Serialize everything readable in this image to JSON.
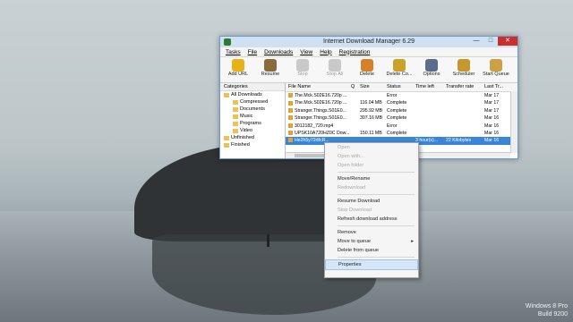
{
  "window": {
    "title": "Internet Download Manager 6.29",
    "controls": {
      "minimize": "—",
      "maximize": "□",
      "close": "✕"
    }
  },
  "menu": [
    "Tasks",
    "File",
    "Downloads",
    "View",
    "Help",
    "Registration"
  ],
  "toolbar": [
    {
      "label": "Add URL",
      "icon": "add-url-icon",
      "color": "#e7b219",
      "enabled": true
    },
    {
      "label": "Resume",
      "icon": "resume-icon",
      "color": "#8a6b3a",
      "enabled": true
    },
    {
      "label": "Stop",
      "icon": "stop-icon",
      "color": "#9a9a9a",
      "enabled": false
    },
    {
      "label": "Stop All",
      "icon": "stop-all-icon",
      "color": "#9a9a9a",
      "enabled": false
    },
    {
      "label": "Delete",
      "icon": "delete-icon",
      "color": "#d6812a",
      "enabled": true
    },
    {
      "label": "Delete Co...",
      "icon": "delete-completed-icon",
      "color": "#c9a22c",
      "enabled": true
    },
    {
      "label": "Options",
      "icon": "options-icon",
      "color": "#5b6d8a",
      "enabled": true
    },
    {
      "label": "Scheduler",
      "icon": "scheduler-icon",
      "color": "#c8962e",
      "enabled": true
    },
    {
      "label": "Start Queue",
      "icon": "start-queue-icon",
      "color": "#caa245",
      "enabled": true
    }
  ],
  "categories": {
    "header": "Categories",
    "items": [
      {
        "label": "All Downloads",
        "indent": 0
      },
      {
        "label": "Compressed",
        "indent": 1
      },
      {
        "label": "Documents",
        "indent": 1
      },
      {
        "label": "Music",
        "indent": 1
      },
      {
        "label": "Programs",
        "indent": 1
      },
      {
        "label": "Video",
        "indent": 1
      },
      {
        "label": "Unfinished",
        "indent": 0
      },
      {
        "label": "Finished",
        "indent": 0
      }
    ]
  },
  "columns": [
    "File Name",
    "Q",
    "Size",
    "Status",
    "Time left",
    "Transfer rate",
    "Last Tr..."
  ],
  "files": [
    {
      "name": "The.Mck.S02E16.720p ...",
      "q": "",
      "size": "",
      "status": "Error",
      "time": "",
      "rate": "",
      "last": "Mar 17"
    },
    {
      "name": "The.Mck.S02E16.720p ...",
      "q": "",
      "size": "116.04 MB",
      "status": "Complete",
      "time": "",
      "rate": "",
      "last": "Mar 17"
    },
    {
      "name": "Stranger.Things.S01E0...",
      "q": "",
      "size": "295.92 MB",
      "status": "Complete",
      "time": "",
      "rate": "",
      "last": "Mar 17"
    },
    {
      "name": "Stranger.Things.S01E0...",
      "q": "",
      "size": "307.16 MB",
      "status": "Complete",
      "time": "",
      "rate": "",
      "last": "Mar 16"
    },
    {
      "name": "3012182_720.mp4",
      "q": "",
      "size": "",
      "status": "Error",
      "time": "",
      "rate": "",
      "last": "Mar 16"
    },
    {
      "name": "UPSK10A720HZ0C Dow...",
      "q": "",
      "size": "150.11 MB",
      "status": "Complete",
      "time": "",
      "rate": "",
      "last": "Mar 16"
    },
    {
      "name": "He2h5y72dfcR...",
      "q": "",
      "size": "",
      "status": "",
      "time": "3 hour(s)...",
      "rate": "22 Kilobytes",
      "last": "Mar 16"
    }
  ],
  "context_menu": [
    {
      "label": "Open",
      "enabled": false
    },
    {
      "label": "Open with...",
      "enabled": false
    },
    {
      "label": "Open folder",
      "enabled": false
    },
    {
      "sep": true
    },
    {
      "label": "Move/Rename",
      "enabled": true
    },
    {
      "label": "Redownload",
      "enabled": false
    },
    {
      "sep": true
    },
    {
      "label": "Resume Download",
      "enabled": true
    },
    {
      "label": "Stop Download",
      "enabled": false
    },
    {
      "label": "Refresh download address",
      "enabled": true
    },
    {
      "sep": true
    },
    {
      "label": "Remove",
      "enabled": true
    },
    {
      "label": "Move to queue",
      "enabled": true,
      "submenu": true
    },
    {
      "label": "Delete from queue",
      "enabled": true
    },
    {
      "sep": true
    },
    {
      "label": "Properties",
      "enabled": true,
      "highlighted": true
    }
  ],
  "watermark": {
    "line1": "Windows 8 Pro",
    "line2": "Build 9200"
  }
}
